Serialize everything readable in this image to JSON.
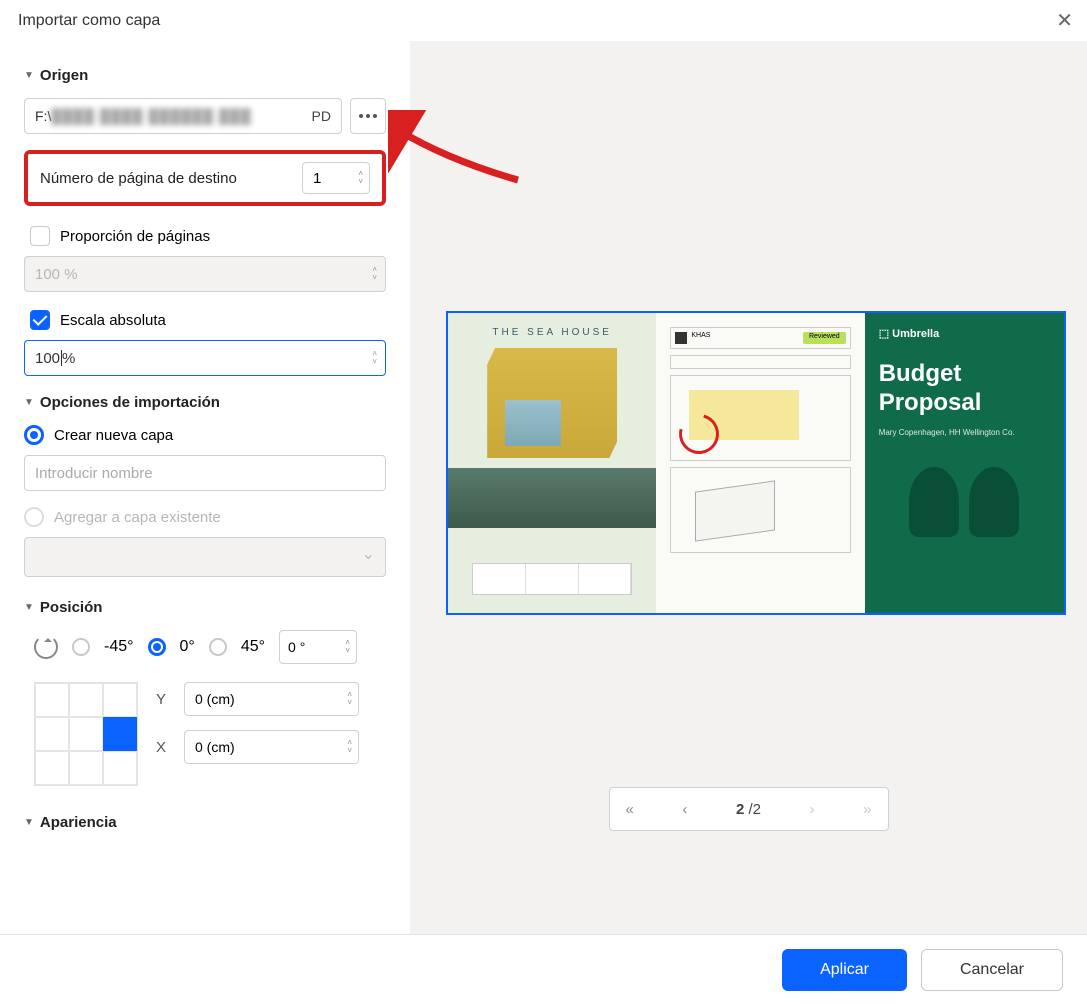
{
  "title": "Importar como capa",
  "source": {
    "header": "Origen",
    "path_prefix": "F:\\",
    "path_ext": "PD",
    "target_page_label": "Número de página de destino",
    "target_page_value": "1",
    "ratio_label": "Proporción de páginas",
    "ratio_value": "100 %",
    "abs_label": "Escala absoluta",
    "abs_value": "100",
    "abs_suffix": " %"
  },
  "import": {
    "header": "Opciones de importación",
    "new_layer": "Crear nueva capa",
    "name_placeholder": "Introducir nombre",
    "existing": "Agregar a capa existente"
  },
  "position": {
    "header": "Posición",
    "neg45": "-45°",
    "zero": "0°",
    "pos45": "45°",
    "deg_value": "0 °",
    "y_label": "Y",
    "y_value": "0 (cm)",
    "x_label": "X",
    "x_value": "0 (cm)"
  },
  "appearance": {
    "header": "Apariencia"
  },
  "preview": {
    "pane1_title": "THE SEA HOUSE",
    "pane2_reviewed": "Reviewed",
    "pane3_logo": "Umbrella",
    "pane3_h1a": "Budget",
    "pane3_h1b": "Proposal",
    "pane3_sub": "Mary Copenhagen, HH Wellington Co."
  },
  "pager": {
    "current": "2",
    "sep": " /",
    "total": "2"
  },
  "footer": {
    "apply": "Aplicar",
    "cancel": "Cancelar"
  }
}
